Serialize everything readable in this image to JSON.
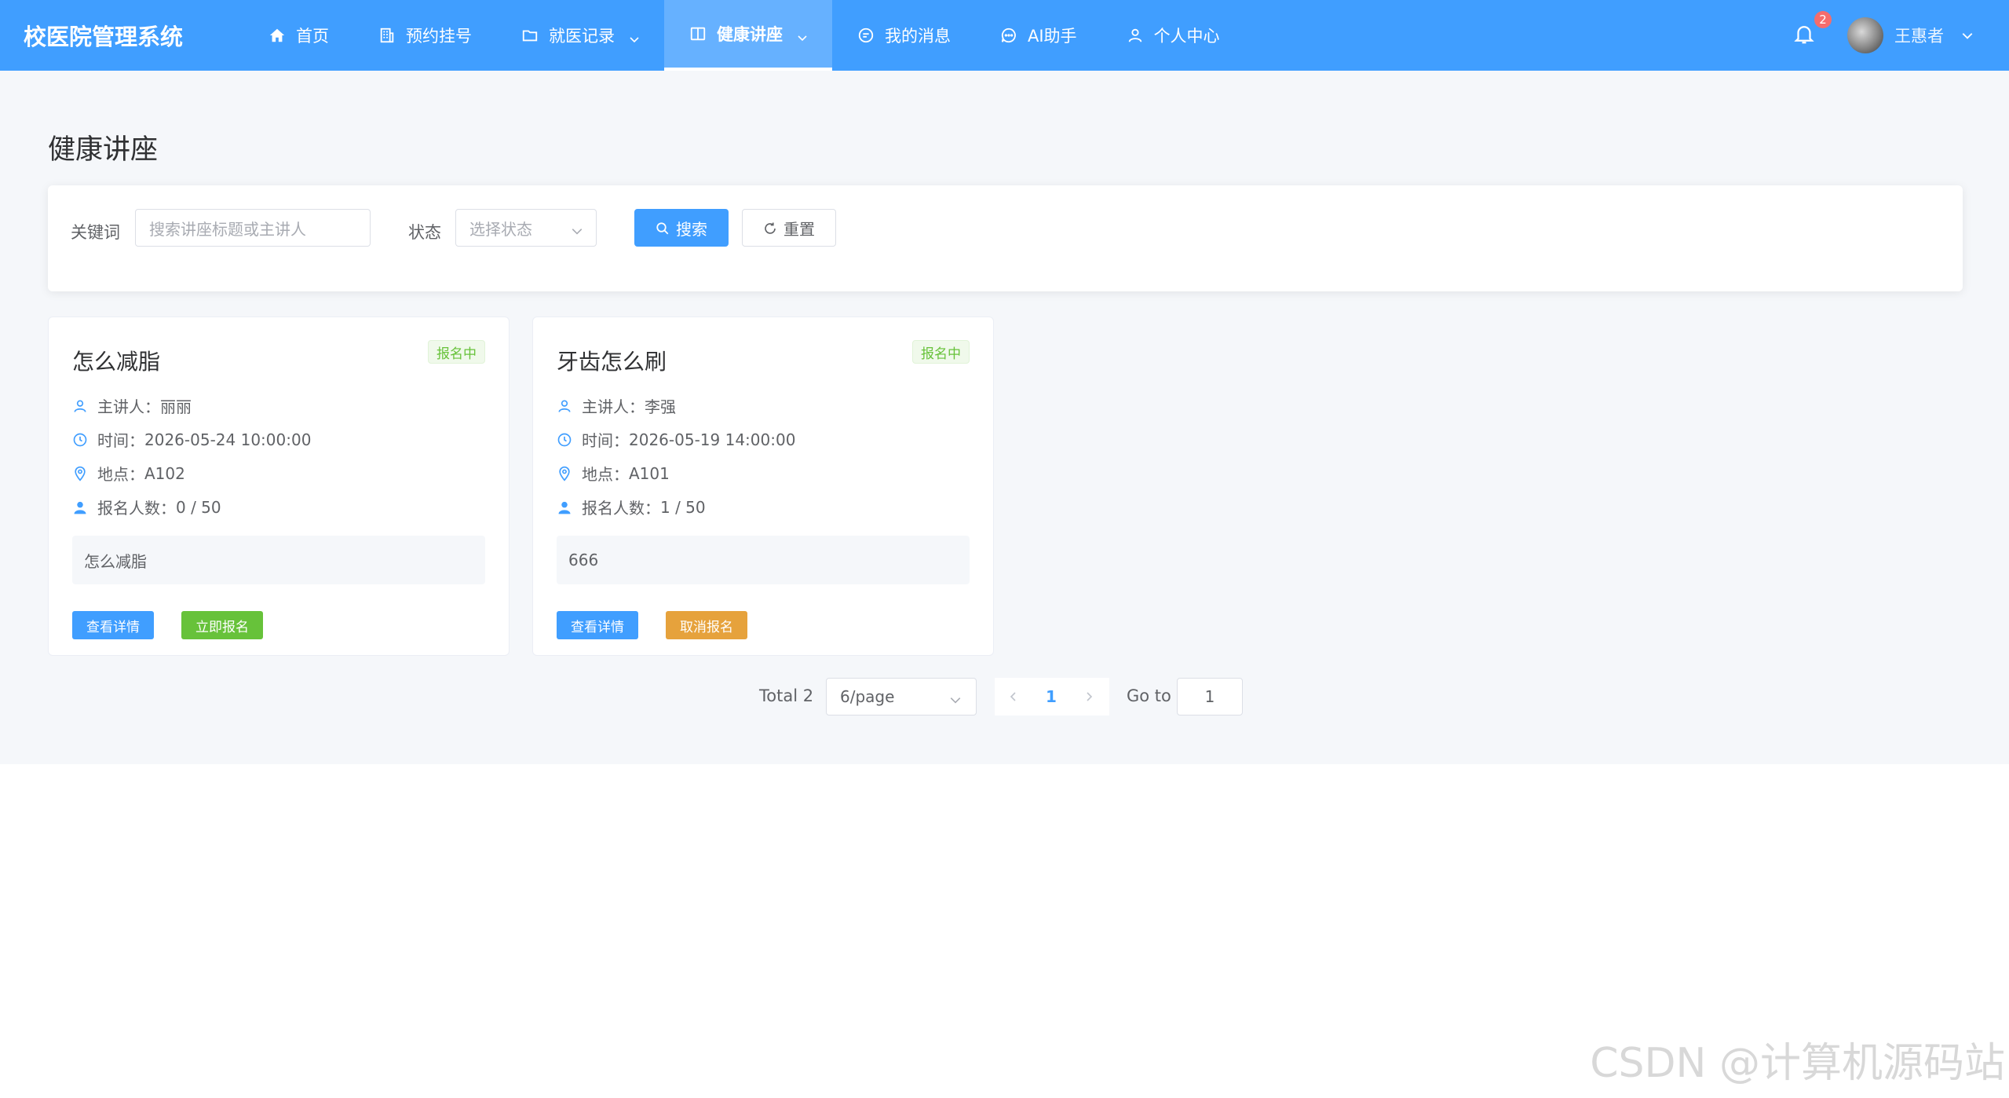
{
  "app": {
    "title": "校医院管理系统"
  },
  "nav": {
    "home": "首页",
    "appointment": "预约挂号",
    "records": "就医记录",
    "lectures": "健康讲座",
    "messages": "我的消息",
    "ai": "AI助手",
    "profile": "个人中心"
  },
  "user": {
    "name": "王惠者",
    "notification_count": "2"
  },
  "page": {
    "title": "健康讲座"
  },
  "filter": {
    "keyword_label": "关键词",
    "keyword_placeholder": "搜索讲座标题或主讲人",
    "status_label": "状态",
    "status_placeholder": "选择状态",
    "search_label": "搜索",
    "reset_label": "重置"
  },
  "lectures": [
    {
      "title": "怎么减脂",
      "status": "报名中",
      "speaker_label": "主讲人：",
      "speaker": "丽丽",
      "time_label": "时间：",
      "time": "2026-05-24 10:00:00",
      "location_label": "地点：",
      "location": "A102",
      "count_label": "报名人数：",
      "count": "0 / 50",
      "description": "怎么减脂",
      "detail_button": "查看详情",
      "action_button": "立即报名"
    },
    {
      "title": "牙齿怎么刷",
      "status": "报名中",
      "speaker_label": "主讲人：",
      "speaker": "李强",
      "time_label": "时间：",
      "time": "2026-05-19 14:00:00",
      "location_label": "地点：",
      "location": "A101",
      "count_label": "报名人数：",
      "count": "1 / 50",
      "description": "666",
      "detail_button": "查看详情",
      "action_button": "取消报名"
    }
  ],
  "pagination": {
    "total": "Total 2",
    "page_size": "6/page",
    "current_page": "1",
    "goto_label": "Go to",
    "goto_value": "1"
  },
  "watermark": "CSDN @计算机源码站",
  "colors": {
    "primary": "#409eff",
    "success": "#67c23a",
    "warning": "#e6a23c",
    "danger": "#f56c6c",
    "background": "#f5f7fa"
  }
}
